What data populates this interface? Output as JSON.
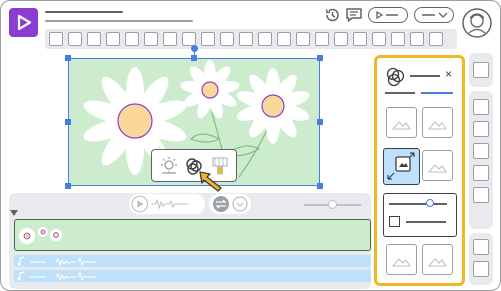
{
  "app": {
    "logo_icon": "play-triangle-logo",
    "brand_color": "#8b3dd1",
    "accent_color": "#4a7de0",
    "highlight_color": "#f0b623"
  },
  "header": {
    "icons": [
      "history-icon",
      "comment-icon",
      "play-preview-icon",
      "dropdown-icon",
      "avatar-icon"
    ]
  },
  "canvas": {
    "image_subject": "daisy-flowers",
    "popup_icons": [
      "adjust-icon",
      "effects-icon",
      "paint-icon"
    ]
  },
  "timeline": {
    "icons": [
      "play-icon",
      "audio-wave-icon",
      "swap-icon",
      "chevron-down-icon",
      "collapse-icon",
      "music-note-icon"
    ]
  },
  "effects_panel": {
    "close_glyph": "×",
    "icons": [
      "effects-icon",
      "image-placeholder-icon",
      "resize-icon",
      "slider-icon",
      "checkbox-icon"
    ]
  }
}
